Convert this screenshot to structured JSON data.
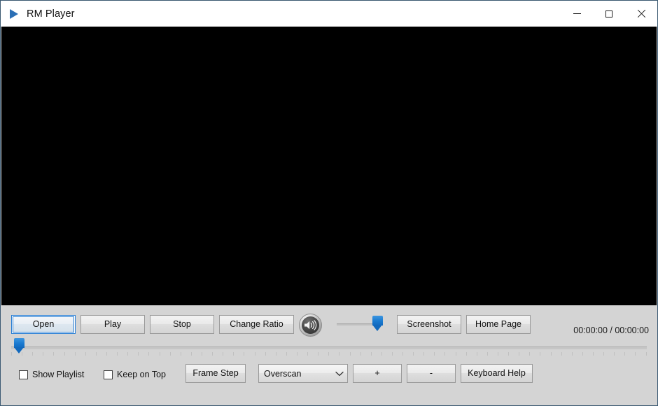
{
  "window": {
    "title": "RM Player",
    "icon": "play-triangle-icon",
    "controls": {
      "minimize": "minimize-icon",
      "maximize": "maximize-icon",
      "close": "close-icon"
    }
  },
  "video": {
    "background_color": "#000000"
  },
  "controls": {
    "row1": {
      "open": "Open",
      "play": "Play",
      "stop": "Stop",
      "change_ratio": "Change Ratio",
      "volume_icon": "speaker-icon",
      "screenshot": "Screenshot",
      "home_page": "Home Page",
      "time": "00:00:00 / 00:00:00",
      "volume_value": 100,
      "focused_button": "Open"
    },
    "seek": {
      "position": 0,
      "tick_count": 61
    },
    "row2": {
      "show_playlist": {
        "label": "Show Playlist",
        "checked": false
      },
      "keep_on_top": {
        "label": "Keep on Top",
        "checked": false
      },
      "frame_step": "Frame Step",
      "overscan": {
        "selected": "Overscan",
        "options": [
          "Overscan"
        ]
      },
      "plus": "+",
      "minus": "-",
      "keyboard_help": "Keyboard Help"
    }
  },
  "colors": {
    "accent": "#1a7ad0",
    "panel": "#d4d4d4",
    "titlebar": "#ffffff",
    "border": "#3a5871"
  }
}
